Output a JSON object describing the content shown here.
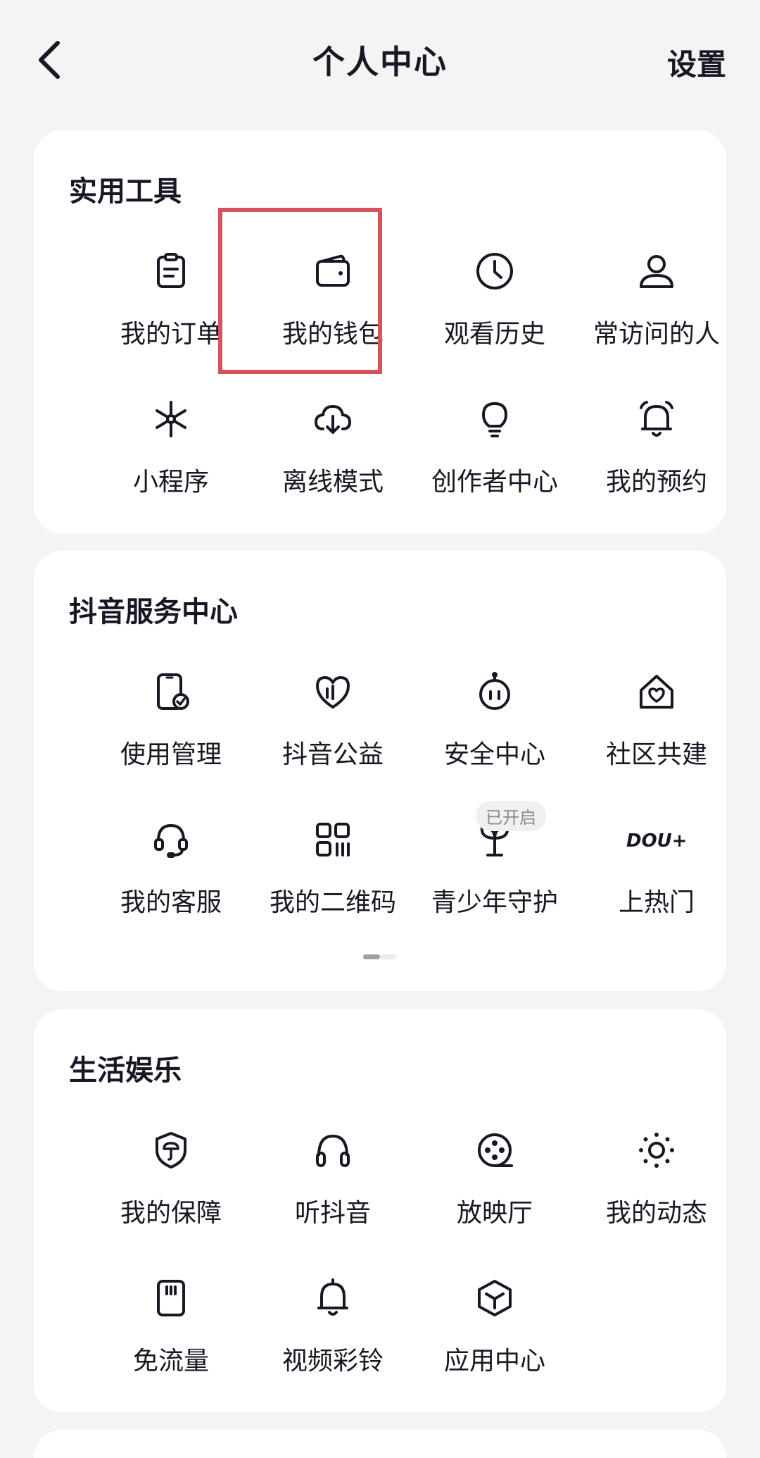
{
  "header": {
    "title": "个人中心",
    "settings_label": "设置"
  },
  "sections": [
    {
      "title": "实用工具",
      "items": [
        {
          "label": "我的订单",
          "icon": "clipboard-icon"
        },
        {
          "label": "我的钱包",
          "icon": "wallet-icon"
        },
        {
          "label": "观看历史",
          "icon": "clock-icon"
        },
        {
          "label": "常访问的人",
          "icon": "person-icon"
        },
        {
          "label": "小程序",
          "icon": "asterisk-icon"
        },
        {
          "label": "离线模式",
          "icon": "cloud-download-icon"
        },
        {
          "label": "创作者中心",
          "icon": "lightbulb-icon"
        },
        {
          "label": "我的预约",
          "icon": "bell-ringing-icon"
        }
      ]
    },
    {
      "title": "抖音服务中心",
      "items": [
        {
          "label": "使用管理",
          "icon": "phone-check-icon"
        },
        {
          "label": "抖音公益",
          "icon": "heart-icon"
        },
        {
          "label": "安全中心",
          "icon": "robot-icon"
        },
        {
          "label": "社区共建",
          "icon": "home-heart-icon"
        },
        {
          "label": "我的客服",
          "icon": "headset-icon"
        },
        {
          "label": "我的二维码",
          "icon": "qr-code-icon"
        },
        {
          "label": "青少年守护",
          "icon": "sprout-icon",
          "badge": "已开启"
        },
        {
          "label": "上热门",
          "icon": "dou-plus-icon",
          "icon_text": "DOU+"
        }
      ]
    },
    {
      "title": "生活娱乐",
      "items": [
        {
          "label": "我的保障",
          "icon": "shield-icon"
        },
        {
          "label": "听抖音",
          "icon": "headphones-icon"
        },
        {
          "label": "放映厅",
          "icon": "film-reel-icon"
        },
        {
          "label": "我的动态",
          "icon": "sun-icon"
        },
        {
          "label": "免流量",
          "icon": "sim-card-icon"
        },
        {
          "label": "视频彩铃",
          "icon": "bell-icon"
        },
        {
          "label": "应用中心",
          "icon": "cube-icon"
        }
      ]
    }
  ],
  "colors": {
    "background": "#f4f4f4",
    "card": "#ffffff",
    "text": "#161823",
    "highlight_border": "#d8525c",
    "badge_text": "#8a8b91"
  }
}
